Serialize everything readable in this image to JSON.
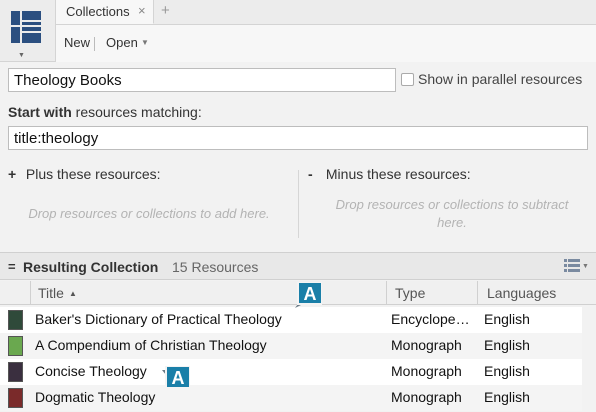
{
  "tabs": {
    "active_label": "Collections",
    "close_glyph": "×",
    "add_glyph": "+"
  },
  "toolbar": {
    "new_label": "New",
    "open_label": "Open"
  },
  "collection": {
    "name": "Theology Books",
    "parallel_label": "Show in parallel resources",
    "parallel_checked": false,
    "start_with_bold": "Start with",
    "start_with_rest": " resources matching:",
    "query": "title:theology"
  },
  "plus": {
    "symbol": "+",
    "heading": "Plus these resources:",
    "placeholder": "Drop resources or collections to add here."
  },
  "minus": {
    "symbol": "-",
    "heading": "Minus these resources:",
    "placeholder_line1": "Drop resources or collections to subtract",
    "placeholder_line2": "here."
  },
  "results": {
    "eq_symbol": "=",
    "title": "Resulting Collection",
    "count_label": "15 Resources"
  },
  "table": {
    "columns": {
      "title": "Title",
      "type": "Type",
      "languages": "Languages"
    },
    "rows": [
      {
        "title": "Baker's Dictionary of Practical Theology",
        "type": "Encyclope…",
        "language": "English",
        "cover_color": "#2f4a3a"
      },
      {
        "title": "A Compendium of Christian Theology",
        "type": "Monograph",
        "language": "English",
        "cover_color": "#6aa84f"
      },
      {
        "title": "Concise Theology",
        "type": "Monograph",
        "language": "English",
        "cover_color": "#3a2f3f"
      },
      {
        "title": "Dogmatic Theology",
        "type": "Monograph",
        "language": "English",
        "cover_color": "#7a2a2a"
      }
    ]
  },
  "badges": {
    "letter": "A",
    "color": "#1a7fa8"
  }
}
